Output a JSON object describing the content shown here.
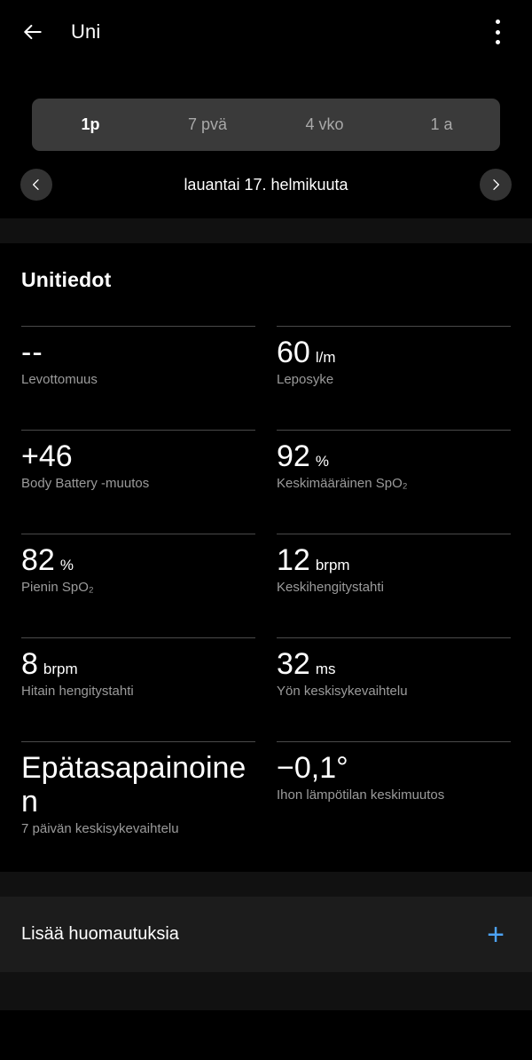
{
  "appbar": {
    "back_icon": "arrow-left-icon",
    "title": "Uni",
    "overflow_icon": "more-vertical-icon"
  },
  "tabs": {
    "items": [
      {
        "label": "1p",
        "active": true
      },
      {
        "label": "7 pvä",
        "active": false
      },
      {
        "label": "4 vko",
        "active": false
      },
      {
        "label": "1 a",
        "active": false
      }
    ]
  },
  "date_selector": {
    "prev_icon": "chevron-left-icon",
    "next_icon": "chevron-right-icon",
    "current": "lauantai 17. helmikuuta"
  },
  "details": {
    "title": "Unitiedot",
    "metrics": [
      {
        "value": "--",
        "unit": "",
        "label": "Levottomuus"
      },
      {
        "value": "60",
        "unit": "l/m",
        "label": "Leposyke"
      },
      {
        "value": "+46",
        "unit": "",
        "label": "Body Battery -muutos"
      },
      {
        "value": "92",
        "unit": "%",
        "label": "Keskimääräinen SpO₂"
      },
      {
        "value": "82",
        "unit": "%",
        "label": "Pienin SpO₂"
      },
      {
        "value": "12",
        "unit": "brpm",
        "label": "Keskihengitystahti"
      },
      {
        "value": "8",
        "unit": "brpm",
        "label": "Hitain hengitystahti"
      },
      {
        "value": "32",
        "unit": "ms",
        "label": "Yön keskisykevaihtelu"
      },
      {
        "value": "Epätasapainoinen",
        "unit": "",
        "label": "7 päivän keskisykevaihtelu"
      },
      {
        "value": "−0,1°",
        "unit": "",
        "label": "Ihon lämpötilan keskimuutos"
      }
    ]
  },
  "notes": {
    "label": "Lisää huomautuksia",
    "add_icon": "plus-icon",
    "add_symbol": "+"
  },
  "colors": {
    "background": "#000000",
    "band": "#111111",
    "tab_bar": "#3a3a3a",
    "circle_button": "#333333",
    "divider": "#4a4a4a",
    "label_text": "#9b9b9b",
    "inactive_tab_text": "#a9a9a9",
    "note_row": "#1c1c1c",
    "accent_blue": "#4da3f5"
  }
}
